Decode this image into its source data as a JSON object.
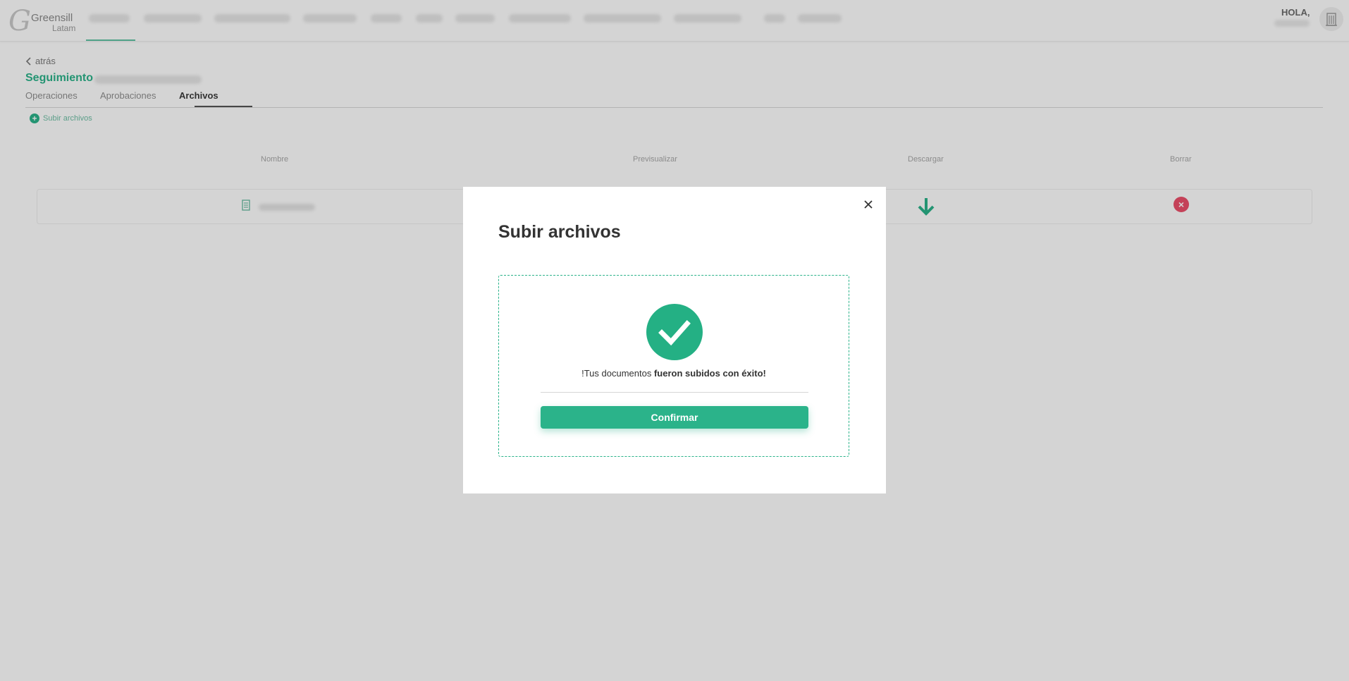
{
  "topbar": {
    "logo_primary": "Greensill",
    "logo_secondary": "Latam",
    "greeting": "HOLA,"
  },
  "page": {
    "back_label": "atrás",
    "title": "Seguimiento",
    "tabs": [
      {
        "label": "Operaciones"
      },
      {
        "label": "Aprobaciones"
      },
      {
        "label": "Archivos"
      }
    ],
    "upload_link": "Subir archivos",
    "table": {
      "headers": [
        "Nombre",
        "Previsualizar",
        "Descargar",
        "Borrar"
      ]
    }
  },
  "modal": {
    "title": "Subir archivos",
    "message_prefix": "!Tus documentos ",
    "message_bold": "fueron subidos con éxito!",
    "confirm_label": "Confirmar"
  },
  "colors": {
    "accent": "#2bb38a",
    "danger": "#ec4f6a",
    "overlay": "rgba(0,0,0,0.17)"
  },
  "icons": {
    "back": "chevron-left-icon",
    "close": "close-icon",
    "success": "checkmark-icon",
    "upload": "plus-circle-icon",
    "download": "arrow-down-icon",
    "delete": "x-circle-icon",
    "file": "document-icon",
    "avatar": "building-icon"
  }
}
